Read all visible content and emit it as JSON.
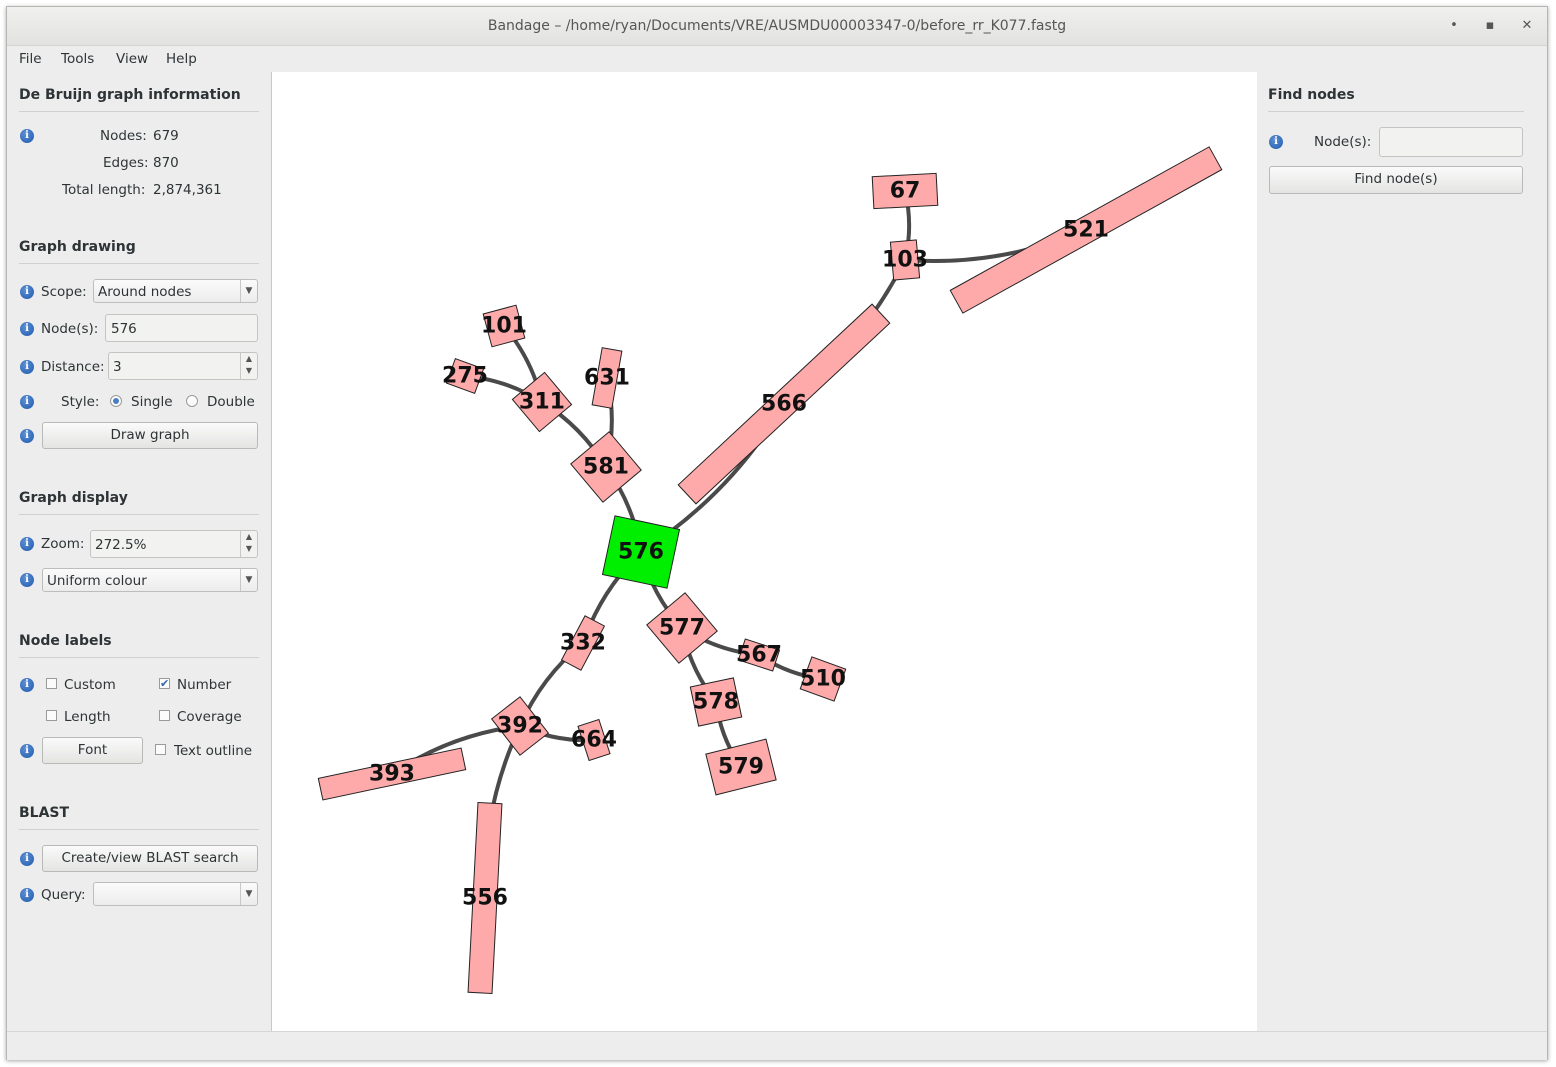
{
  "window": {
    "title": "Bandage – /home/ryan/Documents/VRE/AUSMDU00003347-0/before_rr_K077.fastg",
    "minimize": "•",
    "maximize": "▪",
    "close": "✕"
  },
  "menu": [
    "File",
    "Tools",
    "View",
    "Help"
  ],
  "graph_info": {
    "heading": "De Bruijn graph information",
    "nodes_label": "Nodes:",
    "nodes_value": "679",
    "edges_label": "Edges:",
    "edges_value": "870",
    "length_label": "Total length:",
    "length_value": "2,874,361"
  },
  "graph_drawing": {
    "heading": "Graph drawing",
    "scope_label": "Scope:",
    "scope_value": "Around nodes",
    "nodes_label": "Node(s):",
    "nodes_value": "576",
    "distance_label": "Distance:",
    "distance_value": "3",
    "style_label": "Style:",
    "style_single": "Single",
    "style_double": "Double",
    "draw_button": "Draw graph"
  },
  "graph_display": {
    "heading": "Graph display",
    "zoom_label": "Zoom:",
    "zoom_value": "272.5%",
    "colour_value": "Uniform colour"
  },
  "node_labels": {
    "heading": "Node labels",
    "custom": "Custom",
    "number": "Number",
    "length": "Length",
    "coverage": "Coverage",
    "font_button": "Font",
    "text_outline": "Text outline"
  },
  "blast": {
    "heading": "BLAST",
    "create_button": "Create/view BLAST search",
    "query_label": "Query:",
    "query_value": ""
  },
  "find_nodes": {
    "heading": "Find nodes",
    "nodes_label": "Node(s):",
    "nodes_value": "",
    "find_button": "Find node(s)"
  },
  "icons": {
    "info": "info-icon",
    "dropdown": "chevron-down-icon",
    "spin": "spin-arrows-icon"
  },
  "colors": {
    "node_default": "#ffaaaa",
    "node_selected": "#00ee00",
    "edge": "#4a4a4a"
  },
  "graph": {
    "nodes": [
      {
        "id": "576",
        "selected": true
      },
      {
        "id": "581"
      },
      {
        "id": "311"
      },
      {
        "id": "101"
      },
      {
        "id": "275"
      },
      {
        "id": "631"
      },
      {
        "id": "566"
      },
      {
        "id": "103"
      },
      {
        "id": "67"
      },
      {
        "id": "521"
      },
      {
        "id": "332"
      },
      {
        "id": "392"
      },
      {
        "id": "393"
      },
      {
        "id": "556"
      },
      {
        "id": "664"
      },
      {
        "id": "577"
      },
      {
        "id": "567"
      },
      {
        "id": "510"
      },
      {
        "id": "578"
      },
      {
        "id": "579"
      }
    ],
    "edges": [
      [
        "576",
        "581"
      ],
      [
        "581",
        "311"
      ],
      [
        "581",
        "631"
      ],
      [
        "311",
        "101"
      ],
      [
        "311",
        "275"
      ],
      [
        "576",
        "566"
      ],
      [
        "566",
        "103"
      ],
      [
        "103",
        "67"
      ],
      [
        "103",
        "521"
      ],
      [
        "576",
        "332"
      ],
      [
        "332",
        "392"
      ],
      [
        "392",
        "393"
      ],
      [
        "392",
        "556"
      ],
      [
        "392",
        "664"
      ],
      [
        "576",
        "577"
      ],
      [
        "577",
        "567"
      ],
      [
        "567",
        "510"
      ],
      [
        "577",
        "578"
      ],
      [
        "578",
        "579"
      ]
    ]
  }
}
